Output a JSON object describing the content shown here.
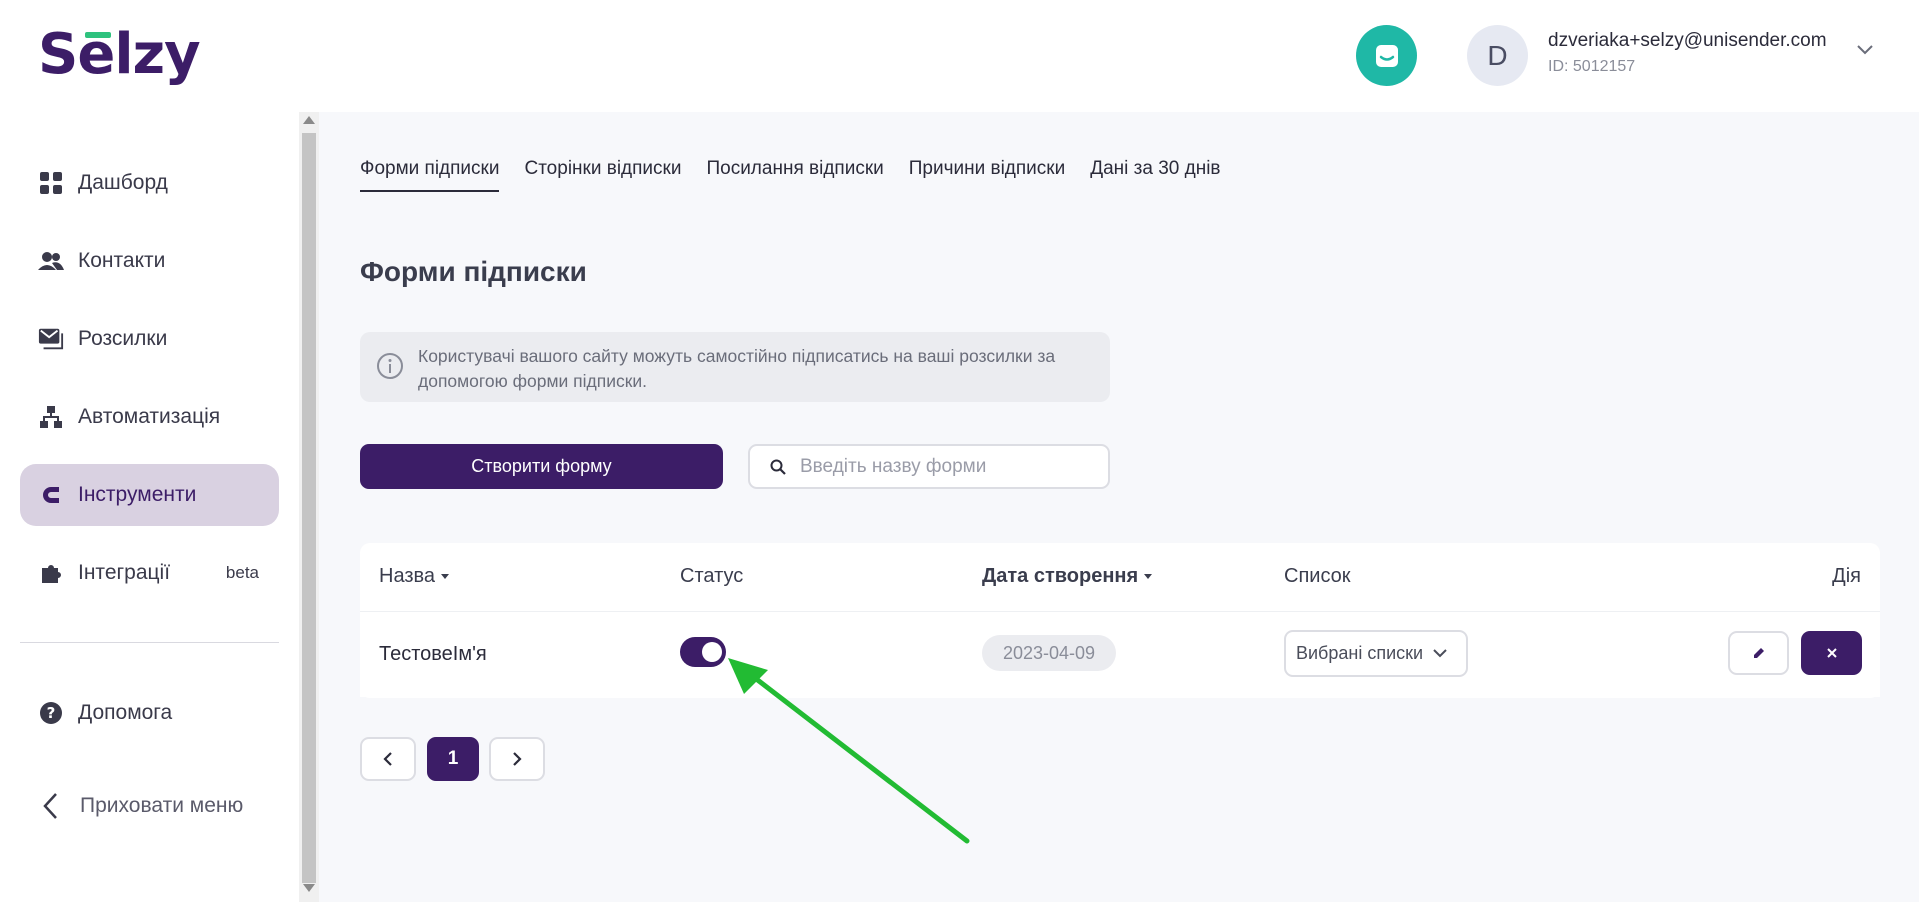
{
  "header": {
    "logo_prefix": "S",
    "logo_e": "e",
    "logo_suffix": "lzy",
    "user_initial": "D",
    "user_email": "dzveriaka+selzy@unisender.com",
    "user_id": "ID: 5012157"
  },
  "sidebar": {
    "items": [
      {
        "label": "Дашборд",
        "icon": "dashboard-icon"
      },
      {
        "label": "Контакти",
        "icon": "contacts-icon"
      },
      {
        "label": "Розсилки",
        "icon": "mail-icon"
      },
      {
        "label": "Автоматизація",
        "icon": "automation-icon"
      },
      {
        "label": "Інструменти",
        "icon": "magnet-icon"
      },
      {
        "label": "Інтеграції",
        "icon": "puzzle-icon",
        "badge": "beta"
      },
      {
        "label": "Допомога",
        "icon": "help-icon"
      }
    ],
    "hide_menu": "Приховати меню"
  },
  "main": {
    "tabs": [
      "Форми підписки",
      "Сторінки відписки",
      "Посилання відписки",
      "Причини відписки",
      "Дані за 30 днів"
    ],
    "title": "Форми підписки",
    "info_text": "Користувачі вашого сайту можуть самостійно підписатись на ваші розсилки за допомогою форми підписки.",
    "create_button": "Створити форму",
    "search_placeholder": "Введіть назву форми"
  },
  "table": {
    "headers": {
      "name": "Назва",
      "status": "Статус",
      "created": "Дата створення",
      "list": "Список",
      "action": "Дія"
    },
    "rows": [
      {
        "name": "ТестовеІм'я",
        "status_on": true,
        "created": "2023-04-09",
        "list": "Вибрані списки"
      }
    ]
  },
  "pagination": {
    "current": "1"
  },
  "colors": {
    "brand": "#3c1d67",
    "accent_green": "#2ec27e",
    "chat": "#1fb8a6",
    "arrow": "#22bb33"
  }
}
